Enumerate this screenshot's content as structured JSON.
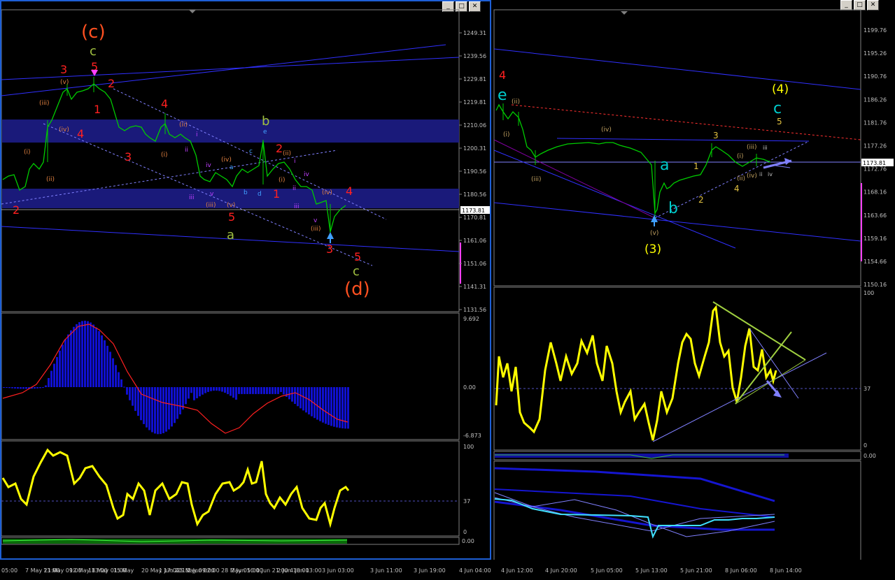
{
  "left_chart": {
    "current_price": "1173.81",
    "price_ticks": [
      "1249.31",
      "1239.56",
      "1229.81",
      "1219.81",
      "1210.06",
      "1200.31",
      "1190.56",
      "1180.56",
      "1170.81",
      "1161.06",
      "1151.06",
      "1141.31",
      "1131.56"
    ],
    "macd_ticks": [
      "9.692",
      "0.00",
      "-6.873"
    ],
    "rsi_ticks": [
      "100",
      "37",
      "0"
    ],
    "vol_ticks": [
      "0.00",
      "0.00"
    ],
    "wave_labels": {
      "big_c": "(c)",
      "big_d": "(d)",
      "minor_c_top": "c",
      "minor_c_bottom": "c",
      "minor_a": "a",
      "minor_b": "b",
      "r3": "3",
      "r5": "5",
      "r2a": "2",
      "r1a": "1",
      "r4a": "4",
      "r4b": "4",
      "r3b": "3",
      "r2b": "2",
      "r1b": "1",
      "r5b": "5",
      "r2c": "2",
      "r3c": "3",
      "r4c": "4",
      "r5c": "5",
      "v_rom": "(v)",
      "iii_rom": "(iii)",
      "iv_rom": "(iv)",
      "i_rom": "(i)",
      "ii_rom": "(ii)",
      "ii2": "(ii)",
      "i2": "(i)",
      "iv2": "(iv)",
      "iii2": "(iii)",
      "v2": "(v)",
      "iv3": "(iv)",
      "iii3": "(iii)",
      "ii3": "(ii)",
      "i3": "(i)",
      "e": "e",
      "c_small": "c",
      "a_small": "a",
      "b_small": "b",
      "d_small": "d",
      "i_s": "i",
      "ii_s": "ii",
      "iii_s": "iii",
      "iv_s": "iv",
      "v_s": "v",
      "i_s2": "i",
      "ii_s2": "ii",
      "iii_s2": "iii",
      "iv_s2": "iv",
      "v_s2": "v"
    }
  },
  "right_chart": {
    "current_price": "1173.81",
    "price_ticks": [
      "1199.76",
      "1195.26",
      "1190.76",
      "1186.26",
      "1181.76",
      "1177.26",
      "1172.76",
      "1168.16",
      "1163.66",
      "1159.16",
      "1154.66",
      "1150.16"
    ],
    "rsi_ticks": [
      "100",
      "37",
      "0"
    ],
    "vol_ticks": [
      "0.00",
      "0.00"
    ],
    "wave_labels": {
      "r4": "4",
      "e": "e",
      "ii": "(ii)",
      "i": "(i)",
      "iii": "(iii)",
      "iv": "(iv)",
      "v": "(v)",
      "wave3": "(3)",
      "wave4": "(4)",
      "a": "a",
      "b": "b",
      "c": "c",
      "n1": "1",
      "n2": "2",
      "n3": "3",
      "n4": "4",
      "n5": "5",
      "i2": "(i)",
      "ii2": "(ii)",
      "iii2": "(iii)",
      "iv2": "(iv)",
      "iii_s": "iii",
      "iv_s": "iv",
      "ii_s": "ii"
    }
  },
  "timebar": {
    "labels": [
      "05:00",
      "7 May 21:00",
      "13 May 09:00",
      "12 May 13:00",
      "18 May 01:00",
      "15 May",
      "20 May 17:00",
      "1 Jun 2015",
      "25 May 09:00",
      "2 Jun 02:00",
      "28 May 05:00",
      "2 Jun 10:00",
      "1 Jun 21:00",
      "2 Jun 18:00",
      "4 Jun 13:00",
      "3 Jun 03:00",
      "3 Jun 11:00",
      "3 Jun 19:00",
      "4 Jun 04:00",
      "4 Jun 12:00",
      "4 Jun 20:00",
      "5 Jun 05:00",
      "5 Jun 13:00",
      "5 Jun 21:00",
      "8 Jun 06:00",
      "8 Jun 14:00"
    ],
    "left_first": "May 17:00"
  },
  "window_buttons": {
    "minimize": "_",
    "maximize": "□",
    "close": "✕"
  },
  "colors": {
    "background": "#000000",
    "window_border": "#1d5fd6",
    "band": "#1a1a7a",
    "rsi_line": "#ffff00",
    "macd_bar": "#1010d0",
    "signal": "#ff2020"
  }
}
